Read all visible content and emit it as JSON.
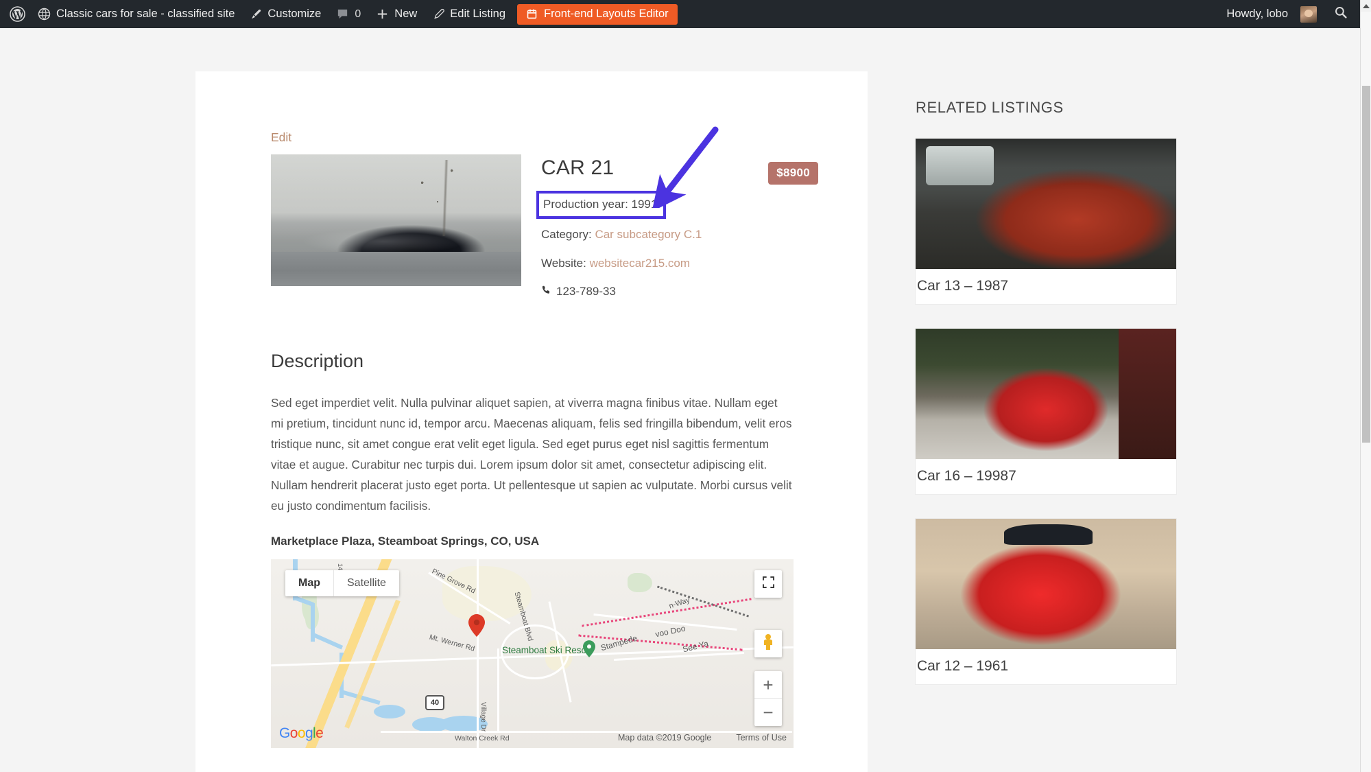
{
  "adminbar": {
    "site_title": "Classic cars for sale - classified site",
    "customize": "Customize",
    "comment_count": "0",
    "new": "New",
    "edit_listing": "Edit Listing",
    "frontend_editor": "Front-end Layouts Editor",
    "howdy": "Howdy, lobo",
    "highlight_color": "#ef5b25",
    "bar_color": "#23282d"
  },
  "listing": {
    "edit_link": "Edit",
    "title": "CAR 21",
    "price": "$8900",
    "price_color": "#b5736a",
    "production_year_label": "Production year:",
    "production_year_value": "1991",
    "production_year": "Production year: 1991",
    "category_label": "Category:",
    "category_value": "Car subcategory C.1",
    "website_label": "Website:",
    "website_value": "websitecar215.com",
    "phone": "123-789-33",
    "link_color": "#c79b85",
    "highlight_box_color": "#4b33e0"
  },
  "description": {
    "heading": "Description",
    "body": "Sed eget imperdiet velit. Nulla pulvinar aliquet sapien, at viverra magna finibus vitae. Nullam eget mi pretium, tincidunt nunc id, tempor arcu. Maecenas aliquam, felis sed fringilla bibendum, velit eros tristique nunc, sit amet congue erat velit eget ligula. Sed eget purus eget nisl sagittis fermentum vitae et augue. Curabitur nec turpis dui. Lorem ipsum dolor sit amet, consectetur adipiscing elit. Nullam hendrerit placerat justo eget porta. Ut pellentesque ut sapien ac vulputate. Morbi cursus velit eu justo condimentum facilisis.",
    "address": "Marketplace Plaza, Steamboat Springs, CO, USA"
  },
  "map": {
    "tab_map": "Map",
    "tab_satellite": "Satellite",
    "zoom_in": "+",
    "zoom_out": "−",
    "logo": "Google",
    "attribution": "Map data ©2019 Google",
    "terms": "Terms of Use",
    "labels": [
      "Pine Grove Rd",
      "Steamboat Blvd",
      "Mt. Werner Rd",
      "Steamboat Ski Resort",
      "Stampede",
      "voo Doo",
      "See Ya",
      "40",
      "Walton Creek Rd",
      "Village Dr",
      "n-Way"
    ]
  },
  "sidebar": {
    "title": "RELATED LISTINGS",
    "listings": [
      {
        "caption": "Car 13 – 1987"
      },
      {
        "caption": "Car 16 – 19987"
      },
      {
        "caption": "Car 12 – 1961"
      }
    ]
  },
  "annotation": {
    "arrow_color": "#4b33e0"
  }
}
